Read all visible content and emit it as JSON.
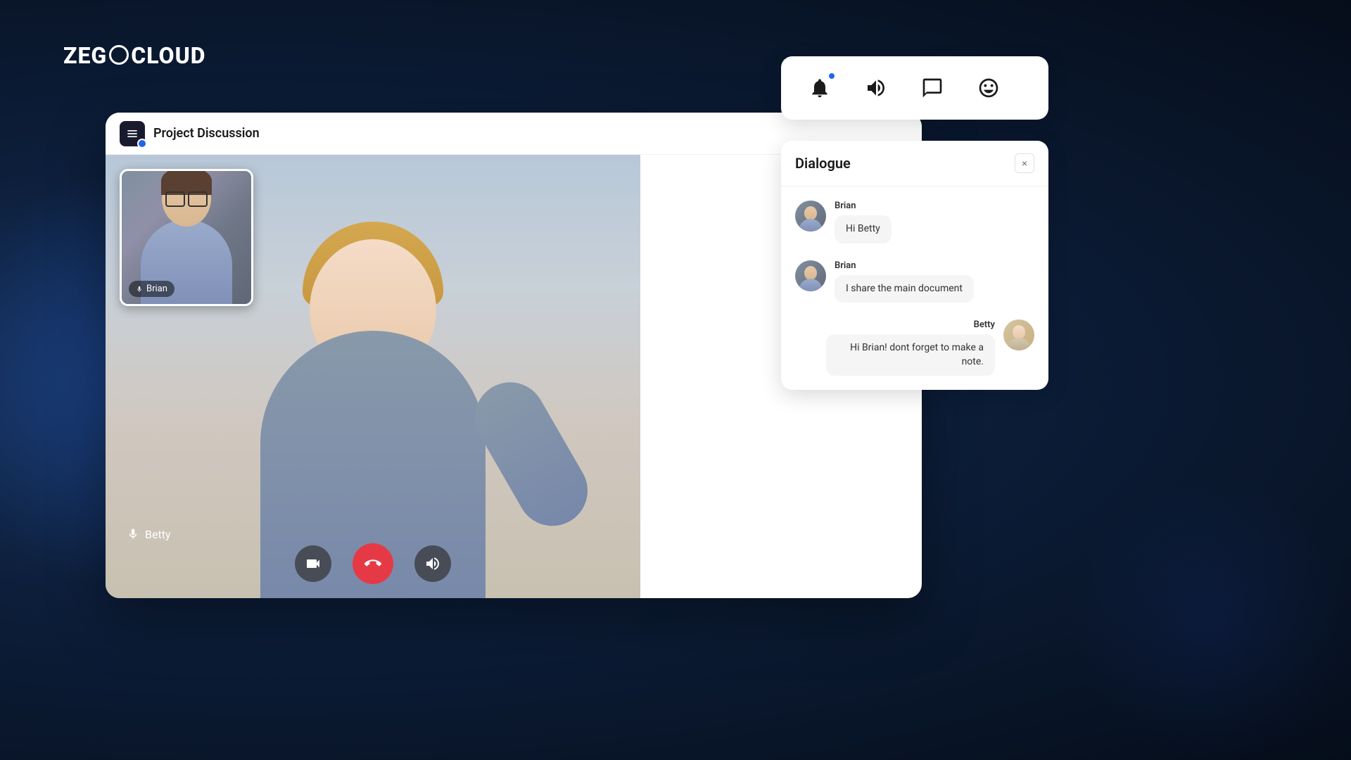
{
  "logo": {
    "text_part1": "ZEG",
    "text_part2": "CLOUD"
  },
  "header": {
    "title": "Project Discussion",
    "icon_alt": "project-icon"
  },
  "video": {
    "main_participant": "Betty",
    "pip_participant": "Brian",
    "pip_name": "Brian"
  },
  "controls": {
    "camera_label": "camera",
    "end_call_label": "end call",
    "speaker_label": "speaker"
  },
  "toolbar": {
    "notification_label": "notifications",
    "sound_label": "sound",
    "chat_label": "chat",
    "emoji_label": "emoji"
  },
  "dialogue": {
    "title": "Dialogue",
    "close_label": "×",
    "messages": [
      {
        "sender": "Brian",
        "text": "Hi Betty",
        "side": "left"
      },
      {
        "sender": "Brian",
        "text": "I share the main document",
        "side": "left"
      },
      {
        "sender": "Betty",
        "text": "Hi Brian! dont forget to make a note.",
        "side": "right"
      }
    ]
  }
}
